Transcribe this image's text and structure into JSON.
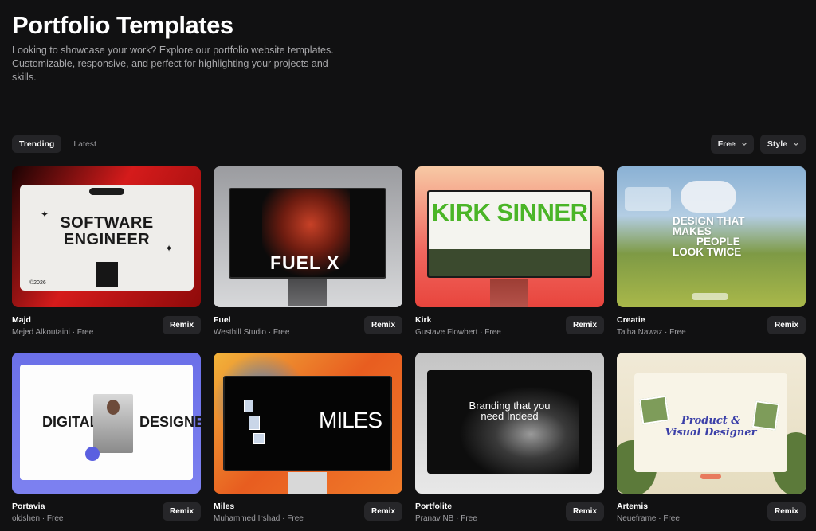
{
  "header": {
    "title": "Portfolio Templates",
    "description": "Looking to showcase your work? Explore our portfolio website templates. Customizable, responsive, and perfect for highlighting your projects and skills."
  },
  "tabs": [
    {
      "label": "Trending",
      "active": true
    },
    {
      "label": "Latest",
      "active": false
    }
  ],
  "filters": [
    {
      "label": "Free",
      "icon": "chevron-down-icon"
    },
    {
      "label": "Style",
      "icon": "chevron-down-icon"
    }
  ],
  "cards": [
    {
      "name": "Majd",
      "author_line": "Mejed Alkoutaini · Free",
      "action": "Remix",
      "thumb_text": [
        "SOFTWARE",
        "ENGINEER"
      ],
      "thumb_small": "©2026"
    },
    {
      "name": "Fuel",
      "author_line": "Westhill Studio · Free",
      "action": "Remix",
      "thumb_text": "FUEL X"
    },
    {
      "name": "Kirk",
      "author_line": "Gustave Flowbert · Free",
      "action": "Remix",
      "thumb_text": "KIRK SINNER"
    },
    {
      "name": "Creatie",
      "author_line": "Talha Nawaz · Free",
      "action": "Remix",
      "thumb_text": [
        "DESIGN THAT",
        "MAKES",
        "PEOPLE",
        "LOOK TWICE"
      ]
    },
    {
      "name": "Portavia",
      "author_line": "oldshen · Free",
      "action": "Remix",
      "thumb_text": [
        "DIGITAL",
        "DESIGNER"
      ]
    },
    {
      "name": "Miles",
      "author_line": "Muhammed Irshad · Free",
      "action": "Remix",
      "thumb_text": "MILES"
    },
    {
      "name": "Portfolite",
      "author_line": "Pranav NB · Free",
      "action": "Remix",
      "thumb_text": [
        "Branding that you",
        "need Indeed"
      ]
    },
    {
      "name": "Artemis",
      "author_line": "Neueframe · Free",
      "action": "Remix",
      "thumb_text": [
        "Product &",
        "Visual Designer"
      ]
    }
  ]
}
